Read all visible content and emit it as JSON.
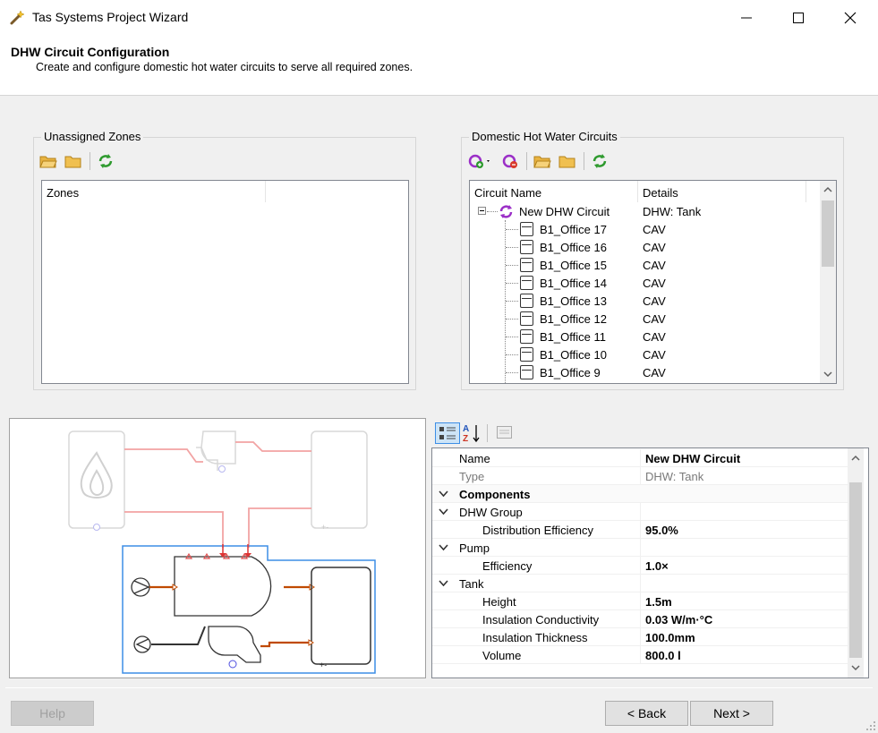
{
  "window": {
    "title": "Tas Systems Project Wizard"
  },
  "header": {
    "title": "DHW Circuit Configuration",
    "subtitle": "Create and configure domestic hot water circuits to serve all required zones."
  },
  "unassigned": {
    "legend": "Unassigned Zones",
    "column": "Zones"
  },
  "circuits": {
    "legend": "Domestic Hot Water Circuits",
    "columns": {
      "name": "Circuit Name",
      "details": "Details"
    },
    "root": {
      "name": "New DHW Circuit",
      "details": "DHW: Tank"
    },
    "zones": [
      {
        "name": "B1_Office 17",
        "details": "CAV"
      },
      {
        "name": "B1_Office 16",
        "details": "CAV"
      },
      {
        "name": "B1_Office 15",
        "details": "CAV"
      },
      {
        "name": "B1_Office 14",
        "details": "CAV"
      },
      {
        "name": "B1_Office 13",
        "details": "CAV"
      },
      {
        "name": "B1_Office 12",
        "details": "CAV"
      },
      {
        "name": "B1_Office 11",
        "details": "CAV"
      },
      {
        "name": "B1_Office 10",
        "details": "CAV"
      },
      {
        "name": "B1_Office 9",
        "details": "CAV"
      }
    ]
  },
  "diagram": {
    "tank_label": "+-"
  },
  "properties": {
    "rows": [
      {
        "label": "Name",
        "value": "New DHW Circuit",
        "kind": "plain"
      },
      {
        "label": "Type",
        "value": "DHW: Tank",
        "kind": "readonly"
      },
      {
        "label": "Components",
        "value": "",
        "kind": "category"
      },
      {
        "label": "DHW Group",
        "value": "",
        "kind": "sub"
      },
      {
        "label": "Distribution Efficiency",
        "value": "95.0%",
        "kind": "child"
      },
      {
        "label": "Pump",
        "value": "",
        "kind": "sub"
      },
      {
        "label": "Efficiency",
        "value": "1.0×",
        "kind": "child"
      },
      {
        "label": "Tank",
        "value": "",
        "kind": "sub"
      },
      {
        "label": "Height",
        "value": "1.5m",
        "kind": "child"
      },
      {
        "label": "Insulation Conductivity",
        "value": "0.03 W/m·°C",
        "kind": "child"
      },
      {
        "label": "Insulation Thickness",
        "value": "100.0mm",
        "kind": "child"
      },
      {
        "label": "Volume",
        "value": "800.0 l",
        "kind": "child"
      }
    ]
  },
  "buttons": {
    "help": "Help",
    "back": "< Back",
    "next": "Next >"
  },
  "colors": {
    "selection": "#3d8ee6",
    "pipe_hot": "#c04a00",
    "pipe_faded": "#f2a3a3",
    "circuit_icon": "#9b2fc7",
    "refresh_icon": "#2e9a2e",
    "folder_icon": "#e8b341"
  }
}
